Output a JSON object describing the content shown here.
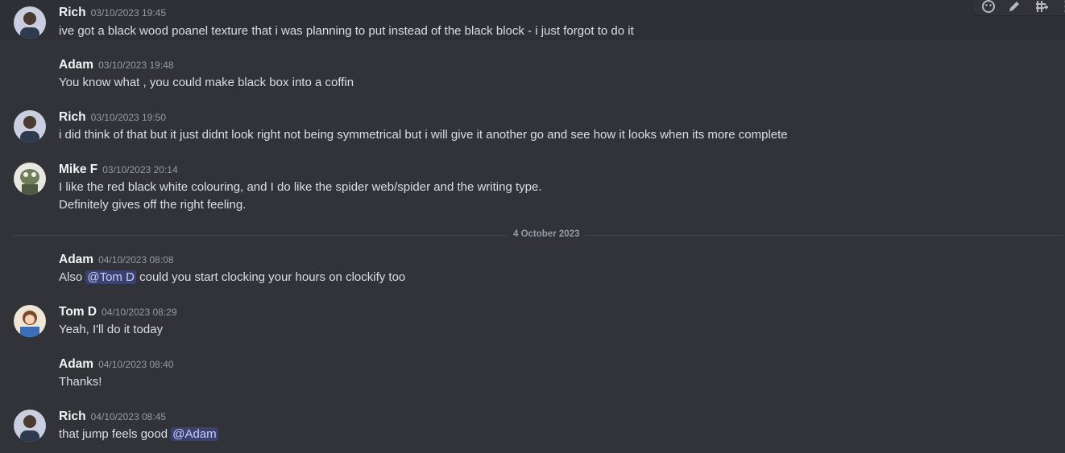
{
  "messages": [
    {
      "author": "Rich",
      "time": "03/10/2023 19:45",
      "lines": [
        "ive got a black wood poanel texture that i was planning to put instead of the black block - i just forgot to do it"
      ]
    },
    {
      "author": "Adam",
      "time": "03/10/2023 19:48",
      "lines": [
        "You know what , you could make black box into a coffin"
      ]
    },
    {
      "author": "Rich",
      "time": "03/10/2023 19:50",
      "lines": [
        "i did think of that but it just didnt look right not being symmetrical but i will give it another go and see how it looks when its more complete"
      ]
    },
    {
      "author": "Mike F",
      "time": "03/10/2023 20:14",
      "lines": [
        "I like the red black white colouring, and I do like the spider web/spider and the writing type.",
        "Definitely gives off the right feeling."
      ]
    },
    {
      "author": "Adam",
      "time": "04/10/2023 08:08",
      "pre": "Also ",
      "mention": "@Tom D",
      "post": " could you start clocking your hours on clockify too"
    },
    {
      "author": "Tom D",
      "time": "04/10/2023 08:29",
      "lines": [
        "Yeah, I'll do it today"
      ]
    },
    {
      "author": "Adam",
      "time": "04/10/2023 08:40",
      "lines": [
        "Thanks!"
      ]
    },
    {
      "author": "Rich",
      "time": "04/10/2023 08:45",
      "pre": "that jump feels good ",
      "mention": "@Adam",
      "post": ""
    }
  ],
  "divider": "4 October 2023",
  "toolbar_icons": [
    "add-reaction-icon",
    "edit-icon",
    "thread-icon",
    "more-icon"
  ],
  "colors": {
    "background": "#313338",
    "mention_bg": "#3c4270",
    "mention_fg": "#c9cdfb",
    "username": "#f2f3f5",
    "timestamp": "#949ba4"
  }
}
